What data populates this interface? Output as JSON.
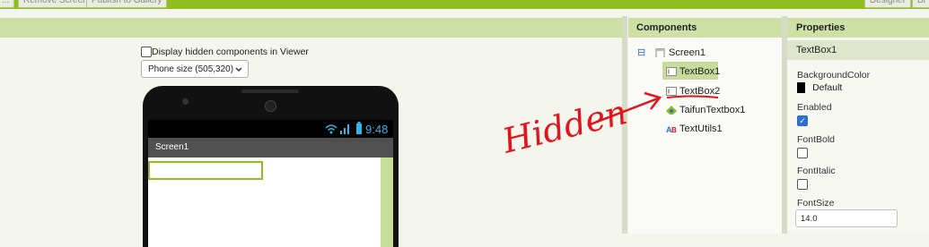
{
  "toolbar": {
    "buttons": [
      "...",
      "Remove Screen",
      "Publish to Gallery"
    ],
    "right_buttons": [
      "Designer",
      "Bl"
    ]
  },
  "viewer": {
    "hidden_checkbox_label": "Display hidden components in Viewer",
    "phone_size": "Phone size (505,320)",
    "status_time": "9:48",
    "screen_title": "Screen1"
  },
  "components": {
    "title": "Components",
    "tree": [
      "Screen1",
      "TextBox1",
      "TextBox2",
      "TaifunTextbox1",
      "TextUtils1"
    ],
    "collapse_glyph": "⊟"
  },
  "annotation": {
    "text": "Hidden",
    "color": "#e0141e"
  },
  "properties": {
    "title": "Properties",
    "component": "TextBox1",
    "background_label": "BackgroundColor",
    "background_value": "Default",
    "enabled_label": "Enabled",
    "enabled": true,
    "fontbold_label": "FontBold",
    "fontitalic_label": "FontItalic",
    "fontsize_label": "FontSize",
    "fontsize_value": "14.0"
  },
  "colors": {
    "accent": "#8fbf1f",
    "header": "#cfe0a7",
    "selected": "#c7dc9a"
  }
}
